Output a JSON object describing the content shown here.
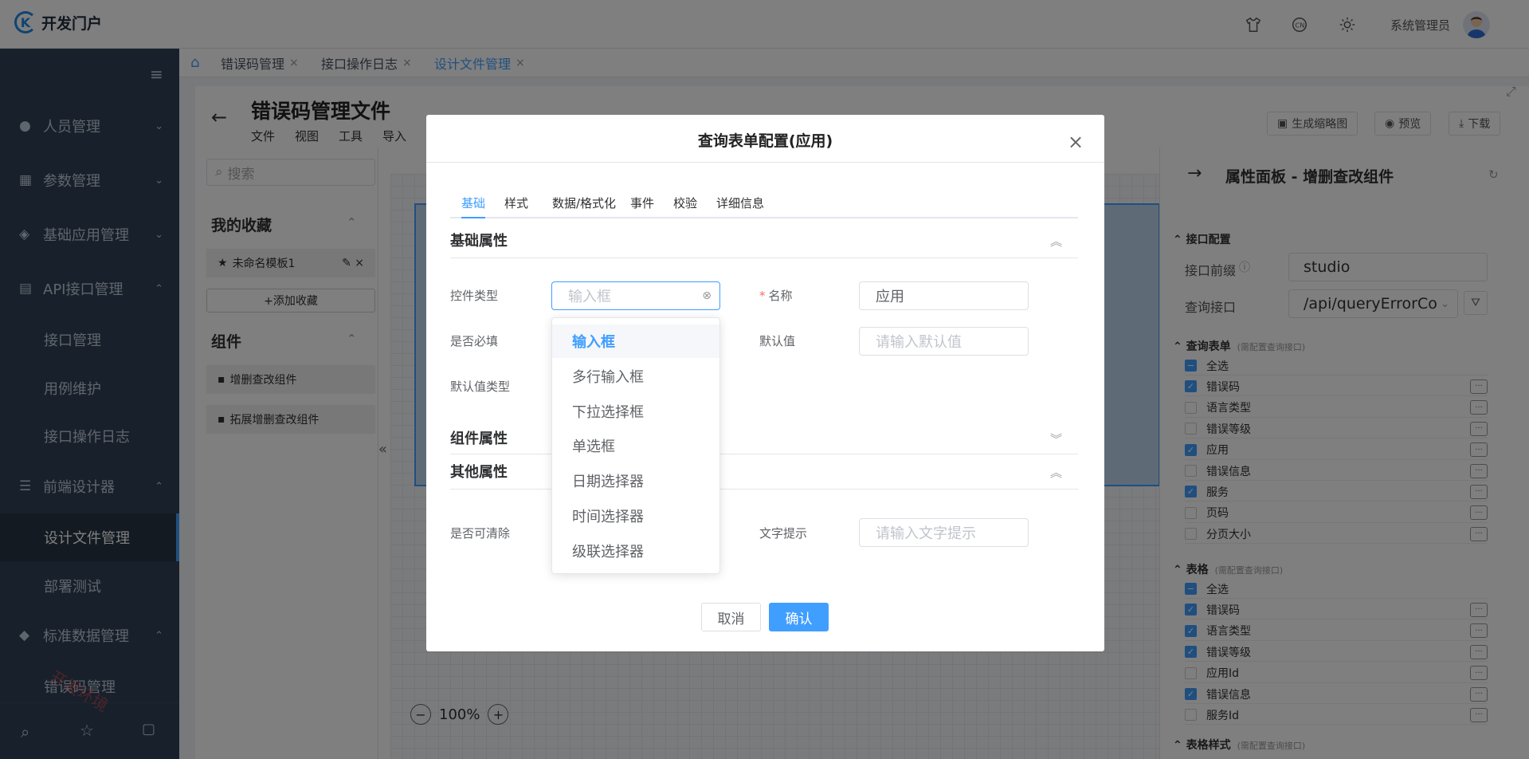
{
  "header": {
    "app_name": "开发门户",
    "username": "系统管理员"
  },
  "sidebar": {
    "items": [
      {
        "label": "人员管理"
      },
      {
        "label": "参数管理"
      },
      {
        "label": "基础应用管理"
      },
      {
        "label": "API接口管理"
      },
      {
        "label": "接口管理"
      },
      {
        "label": "用例维护"
      },
      {
        "label": "接口操作日志"
      },
      {
        "label": "前端设计器"
      },
      {
        "label": "设计文件管理"
      },
      {
        "label": "部署测试"
      },
      {
        "label": "标准数据管理"
      },
      {
        "label": "错误码管理"
      }
    ],
    "corner_text": "开发环境"
  },
  "tabs": [
    {
      "label": "错误码管理"
    },
    {
      "label": "接口操作日志"
    },
    {
      "label": "设计文件管理"
    }
  ],
  "designer": {
    "title": "错误码管理文件",
    "menu": [
      "文件",
      "视图",
      "工具",
      "导入"
    ],
    "toolbar": {
      "thumbnail": "生成缩略图",
      "preview": "预览",
      "download": "下载"
    },
    "search_placeholder": "搜索",
    "favorites_title": "我的收藏",
    "favorite_item": "未命名模板1",
    "add_favorite": "+添加收藏",
    "components_title": "组件",
    "components": [
      "增删查改组件",
      "拓展增删查改组件"
    ],
    "zoom": "100%"
  },
  "right_panel": {
    "title": "属性面板 - 增删查改组件",
    "api_config": "接口配置",
    "api_prefix_label": "接口前缀",
    "api_prefix_value": "studio",
    "query_api_label": "查询接口",
    "query_api_value": "/api/queryErrorCo",
    "query_form": "查询表单",
    "query_form_hint": "(需配置查询接口)",
    "query_fields": [
      {
        "label": "全选",
        "state": "partial"
      },
      {
        "label": "错误码",
        "state": "checked"
      },
      {
        "label": "语言类型",
        "state": "unchecked"
      },
      {
        "label": "错误等级",
        "state": "unchecked"
      },
      {
        "label": "应用",
        "state": "checked"
      },
      {
        "label": "错误信息",
        "state": "unchecked"
      },
      {
        "label": "服务",
        "state": "checked"
      },
      {
        "label": "页码",
        "state": "unchecked"
      },
      {
        "label": "分页大小",
        "state": "unchecked"
      }
    ],
    "table": "表格",
    "table_hint": "(需配置查询接口)",
    "table_fields": [
      {
        "label": "全选",
        "state": "partial"
      },
      {
        "label": "错误码",
        "state": "checked"
      },
      {
        "label": "语言类型",
        "state": "checked"
      },
      {
        "label": "错误等级",
        "state": "checked"
      },
      {
        "label": "应用Id",
        "state": "unchecked"
      },
      {
        "label": "错误信息",
        "state": "checked"
      },
      {
        "label": "服务Id",
        "state": "unchecked"
      }
    ],
    "table_style": "表格样式",
    "table_style_hint": "(需配置查询接口)"
  },
  "dialog": {
    "title": "查询表单配置(应用)",
    "tabs": [
      "基础",
      "样式",
      "数据/格式化",
      "事件",
      "校验",
      "详细信息"
    ],
    "section_basic": "基础属性",
    "control_type_label": "控件类型",
    "control_type_placeholder": "输入框",
    "name_label": "名称",
    "name_value": "应用",
    "required_label": "是否必填",
    "default_label": "默认值",
    "default_placeholder": "请输入默认值",
    "default_type_label": "默认值类型",
    "section_component": "组件属性",
    "section_other": "其他属性",
    "clearable_label": "是否可清除",
    "hint_label": "文字提示",
    "hint_placeholder": "请输入文字提示",
    "cancel": "取消",
    "confirm": "确认"
  },
  "dropdown": {
    "options": [
      "输入框",
      "多行输入框",
      "下拉选择框",
      "单选框",
      "日期选择器",
      "时间选择器",
      "级联选择器"
    ],
    "selected": "输入框"
  }
}
